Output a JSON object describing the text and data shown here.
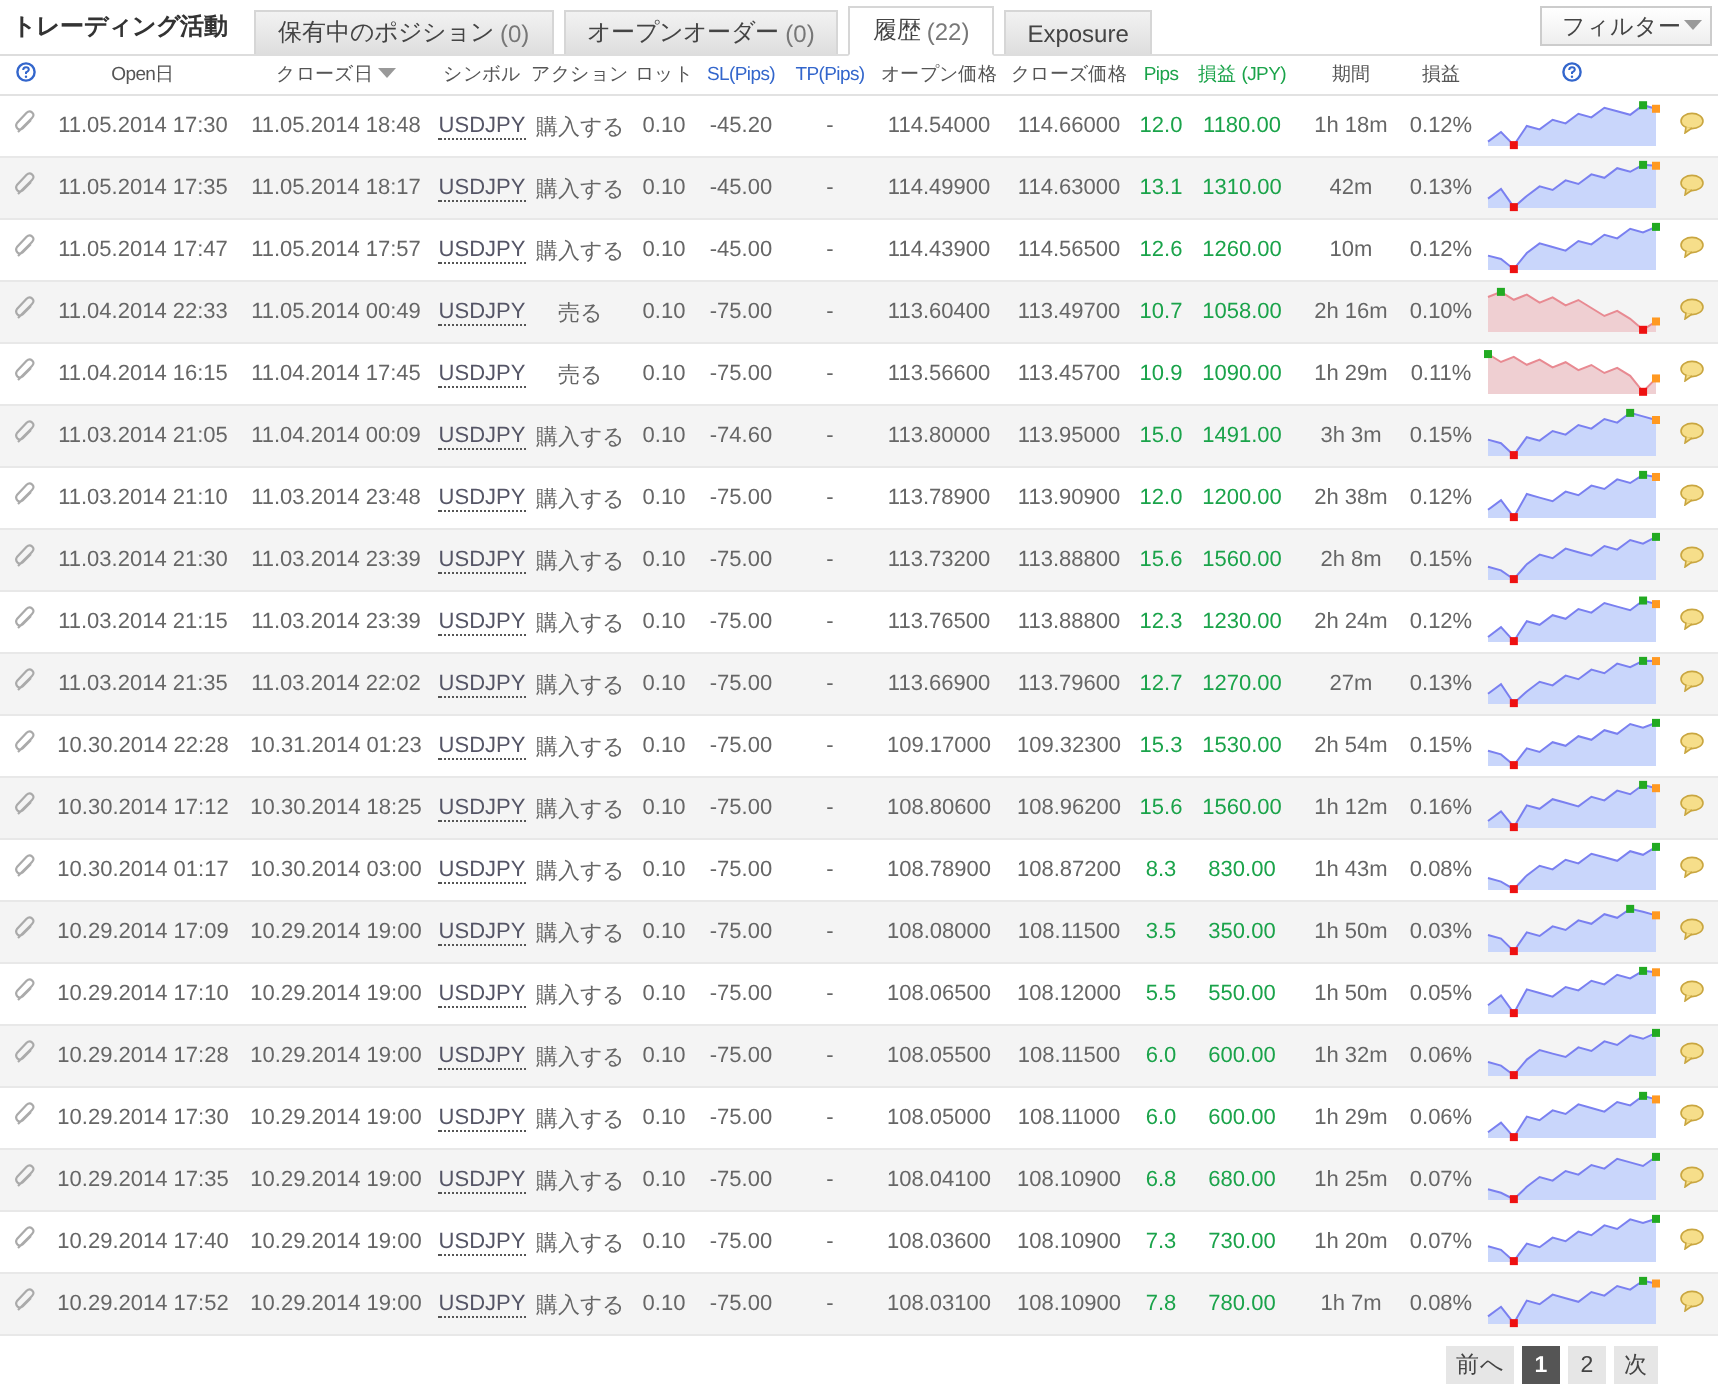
{
  "title": "トレーディング活動",
  "tabs": [
    {
      "label": "保有中のポジション",
      "count": "(0)",
      "selected": false
    },
    {
      "label": "オープンオーダー",
      "count": "(0)",
      "selected": false
    },
    {
      "label": "履歴",
      "count": "(22)",
      "selected": true
    },
    {
      "label": "Exposure",
      "selected": false
    }
  ],
  "filter_button": "フィルター",
  "columns": [
    {
      "label": "Open日",
      "sorted": false
    },
    {
      "label": "クローズ日",
      "sorted": true
    },
    {
      "label": "シンボル",
      "sorted": false
    },
    {
      "label": "アクション",
      "sorted": false
    },
    {
      "label": "ロット",
      "sorted": false
    },
    {
      "label": "SL(Pips)",
      "sorted": false
    },
    {
      "label": "TP(Pips)",
      "sorted": false
    },
    {
      "label": "オープン価格",
      "sorted": false
    },
    {
      "label": "クローズ価格",
      "sorted": false
    },
    {
      "label": "Pips",
      "sorted": false
    },
    {
      "label": "損益 (JPY)",
      "sorted": false
    },
    {
      "label": "期間",
      "sorted": false
    },
    {
      "label": "損益",
      "sorted": false
    }
  ],
  "rows": [
    {
      "kind": "buy",
      "open": "11.05.2014 17:30",
      "close": "11.05.2014 18:48",
      "symbol": "USDJPY",
      "action": "購入する",
      "lot": "0.10",
      "sl": "-45.20",
      "tp": "-",
      "open_price": "114.54000",
      "close_price": "114.66000",
      "pips": "12.0",
      "pnl": "1180.00",
      "period": "1h 18m",
      "pct": "0.12%"
    },
    {
      "kind": "buy",
      "open": "11.05.2014 17:35",
      "close": "11.05.2014 18:17",
      "symbol": "USDJPY",
      "action": "購入する",
      "lot": "0.10",
      "sl": "-45.00",
      "tp": "-",
      "open_price": "114.49900",
      "close_price": "114.63000",
      "pips": "13.1",
      "pnl": "1310.00",
      "period": "42m",
      "pct": "0.13%"
    },
    {
      "kind": "buy",
      "open": "11.05.2014 17:47",
      "close": "11.05.2014 17:57",
      "symbol": "USDJPY",
      "action": "購入する",
      "lot": "0.10",
      "sl": "-45.00",
      "tp": "-",
      "open_price": "114.43900",
      "close_price": "114.56500",
      "pips": "12.6",
      "pnl": "1260.00",
      "period": "10m",
      "pct": "0.12%"
    },
    {
      "kind": "sell",
      "open": "11.04.2014 22:33",
      "close": "11.05.2014 00:49",
      "symbol": "USDJPY",
      "action": "売る",
      "lot": "0.10",
      "sl": "-75.00",
      "tp": "-",
      "open_price": "113.60400",
      "close_price": "113.49700",
      "pips": "10.7",
      "pnl": "1058.00",
      "period": "2h 16m",
      "pct": "0.10%"
    },
    {
      "kind": "sell",
      "open": "11.04.2014 16:15",
      "close": "11.04.2014 17:45",
      "symbol": "USDJPY",
      "action": "売る",
      "lot": "0.10",
      "sl": "-75.00",
      "tp": "-",
      "open_price": "113.56600",
      "close_price": "113.45700",
      "pips": "10.9",
      "pnl": "1090.00",
      "period": "1h 29m",
      "pct": "0.11%"
    },
    {
      "kind": "buy",
      "open": "11.03.2014 21:05",
      "close": "11.04.2014 00:09",
      "symbol": "USDJPY",
      "action": "購入する",
      "lot": "0.10",
      "sl": "-74.60",
      "tp": "-",
      "open_price": "113.80000",
      "close_price": "113.95000",
      "pips": "15.0",
      "pnl": "1491.00",
      "period": "3h 3m",
      "pct": "0.15%"
    },
    {
      "kind": "buy",
      "open": "11.03.2014 21:10",
      "close": "11.03.2014 23:48",
      "symbol": "USDJPY",
      "action": "購入する",
      "lot": "0.10",
      "sl": "-75.00",
      "tp": "-",
      "open_price": "113.78900",
      "close_price": "113.90900",
      "pips": "12.0",
      "pnl": "1200.00",
      "period": "2h 38m",
      "pct": "0.12%"
    },
    {
      "kind": "buy",
      "open": "11.03.2014 21:30",
      "close": "11.03.2014 23:39",
      "symbol": "USDJPY",
      "action": "購入する",
      "lot": "0.10",
      "sl": "-75.00",
      "tp": "-",
      "open_price": "113.73200",
      "close_price": "113.88800",
      "pips": "15.6",
      "pnl": "1560.00",
      "period": "2h 8m",
      "pct": "0.15%"
    },
    {
      "kind": "buy",
      "open": "11.03.2014 21:15",
      "close": "11.03.2014 23:39",
      "symbol": "USDJPY",
      "action": "購入する",
      "lot": "0.10",
      "sl": "-75.00",
      "tp": "-",
      "open_price": "113.76500",
      "close_price": "113.88800",
      "pips": "12.3",
      "pnl": "1230.00",
      "period": "2h 24m",
      "pct": "0.12%"
    },
    {
      "kind": "buy",
      "open": "11.03.2014 21:35",
      "close": "11.03.2014 22:02",
      "symbol": "USDJPY",
      "action": "購入する",
      "lot": "0.10",
      "sl": "-75.00",
      "tp": "-",
      "open_price": "113.66900",
      "close_price": "113.79600",
      "pips": "12.7",
      "pnl": "1270.00",
      "period": "27m",
      "pct": "0.13%"
    },
    {
      "kind": "buy",
      "open": "10.30.2014 22:28",
      "close": "10.31.2014 01:23",
      "symbol": "USDJPY",
      "action": "購入する",
      "lot": "0.10",
      "sl": "-75.00",
      "tp": "-",
      "open_price": "109.17000",
      "close_price": "109.32300",
      "pips": "15.3",
      "pnl": "1530.00",
      "period": "2h 54m",
      "pct": "0.15%"
    },
    {
      "kind": "buy",
      "open": "10.30.2014 17:12",
      "close": "10.30.2014 18:25",
      "symbol": "USDJPY",
      "action": "購入する",
      "lot": "0.10",
      "sl": "-75.00",
      "tp": "-",
      "open_price": "108.80600",
      "close_price": "108.96200",
      "pips": "15.6",
      "pnl": "1560.00",
      "period": "1h 12m",
      "pct": "0.16%"
    },
    {
      "kind": "buy",
      "open": "10.30.2014 01:17",
      "close": "10.30.2014 03:00",
      "symbol": "USDJPY",
      "action": "購入する",
      "lot": "0.10",
      "sl": "-75.00",
      "tp": "-",
      "open_price": "108.78900",
      "close_price": "108.87200",
      "pips": "8.3",
      "pnl": "830.00",
      "period": "1h 43m",
      "pct": "0.08%"
    },
    {
      "kind": "buy",
      "open": "10.29.2014 17:09",
      "close": "10.29.2014 19:00",
      "symbol": "USDJPY",
      "action": "購入する",
      "lot": "0.10",
      "sl": "-75.00",
      "tp": "-",
      "open_price": "108.08000",
      "close_price": "108.11500",
      "pips": "3.5",
      "pnl": "350.00",
      "period": "1h 50m",
      "pct": "0.03%"
    },
    {
      "kind": "buy",
      "open": "10.29.2014 17:10",
      "close": "10.29.2014 19:00",
      "symbol": "USDJPY",
      "action": "購入する",
      "lot": "0.10",
      "sl": "-75.00",
      "tp": "-",
      "open_price": "108.06500",
      "close_price": "108.12000",
      "pips": "5.5",
      "pnl": "550.00",
      "period": "1h 50m",
      "pct": "0.05%"
    },
    {
      "kind": "buy",
      "open": "10.29.2014 17:28",
      "close": "10.29.2014 19:00",
      "symbol": "USDJPY",
      "action": "購入する",
      "lot": "0.10",
      "sl": "-75.00",
      "tp": "-",
      "open_price": "108.05500",
      "close_price": "108.11500",
      "pips": "6.0",
      "pnl": "600.00",
      "period": "1h 32m",
      "pct": "0.06%"
    },
    {
      "kind": "buy",
      "open": "10.29.2014 17:30",
      "close": "10.29.2014 19:00",
      "symbol": "USDJPY",
      "action": "購入する",
      "lot": "0.10",
      "sl": "-75.00",
      "tp": "-",
      "open_price": "108.05000",
      "close_price": "108.11000",
      "pips": "6.0",
      "pnl": "600.00",
      "period": "1h 29m",
      "pct": "0.06%"
    },
    {
      "kind": "buy",
      "open": "10.29.2014 17:35",
      "close": "10.29.2014 19:00",
      "symbol": "USDJPY",
      "action": "購入する",
      "lot": "0.10",
      "sl": "-75.00",
      "tp": "-",
      "open_price": "108.04100",
      "close_price": "108.10900",
      "pips": "6.8",
      "pnl": "680.00",
      "period": "1h 25m",
      "pct": "0.07%"
    },
    {
      "kind": "buy",
      "open": "10.29.2014 17:40",
      "close": "10.29.2014 19:00",
      "symbol": "USDJPY",
      "action": "購入する",
      "lot": "0.10",
      "sl": "-75.00",
      "tp": "-",
      "open_price": "108.03600",
      "close_price": "108.10900",
      "pips": "7.3",
      "pnl": "730.00",
      "period": "1h 20m",
      "pct": "0.07%"
    },
    {
      "kind": "buy",
      "open": "10.29.2014 17:52",
      "close": "10.29.2014 19:00",
      "symbol": "USDJPY",
      "action": "購入する",
      "lot": "0.10",
      "sl": "-75.00",
      "tp": "-",
      "open_price": "108.03100",
      "close_price": "108.10900",
      "pips": "7.8",
      "pnl": "780.00",
      "period": "1h 7m",
      "pct": "0.08%"
    }
  ],
  "pagination": {
    "prev": "前へ",
    "pages": [
      {
        "label": "1",
        "selected": true
      },
      {
        "label": "2",
        "selected": false
      }
    ],
    "next": "次"
  }
}
